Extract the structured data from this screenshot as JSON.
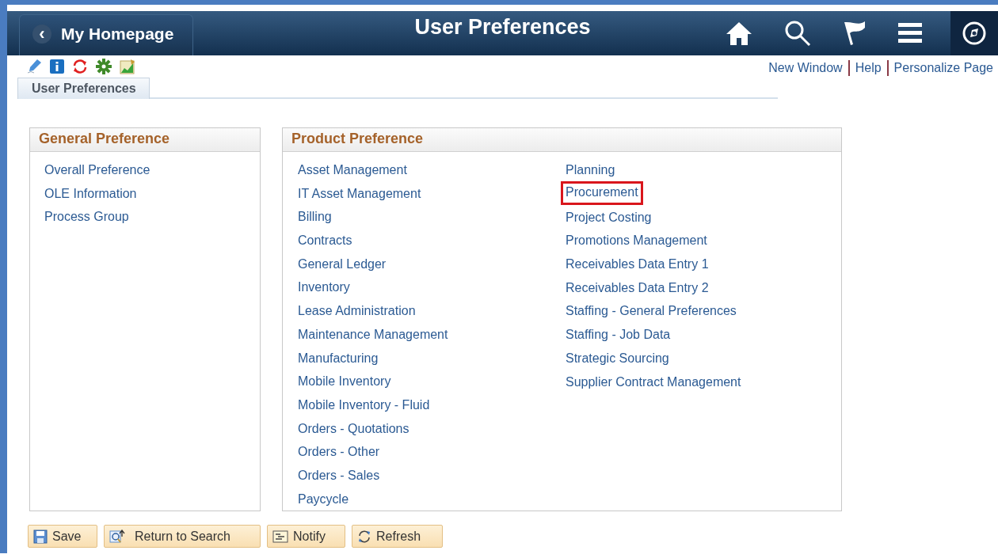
{
  "header": {
    "back_button": "My Homepage",
    "back_glyph": "‹",
    "title": "User Preferences"
  },
  "page_links": [
    "New Window",
    "Help",
    "Personalize Page"
  ],
  "tabs": [
    {
      "label": "User Preferences",
      "selected": true
    }
  ],
  "general_preference": {
    "title": "General Preference",
    "items": [
      "Overall Preference",
      "OLE Information",
      "Process Group"
    ]
  },
  "product_preference": {
    "title": "Product Preference",
    "columns": [
      {
        "items": [
          {
            "label": "Asset Management",
            "highlighted": false
          },
          {
            "label": "IT Asset Management",
            "highlighted": false
          },
          {
            "label": "Billing",
            "highlighted": false
          },
          {
            "label": "Contracts",
            "highlighted": false
          },
          {
            "label": "General Ledger",
            "highlighted": false
          },
          {
            "label": "Inventory",
            "highlighted": false
          },
          {
            "label": "Lease Administration",
            "highlighted": false
          },
          {
            "label": "Maintenance Management",
            "highlighted": false
          },
          {
            "label": "Manufacturing",
            "highlighted": false
          },
          {
            "label": "Mobile Inventory",
            "highlighted": false
          },
          {
            "label": "Mobile Inventory - Fluid",
            "highlighted": false
          },
          {
            "label": "Orders - Quotations",
            "highlighted": false
          },
          {
            "label": "Orders - Other",
            "highlighted": false
          },
          {
            "label": "Orders - Sales",
            "highlighted": false
          },
          {
            "label": "Paycycle",
            "highlighted": false
          }
        ]
      },
      {
        "items": [
          {
            "label": "Planning",
            "highlighted": false
          },
          {
            "label": "Procurement",
            "highlighted": true
          },
          {
            "label": "Project Costing",
            "highlighted": false
          },
          {
            "label": "Promotions Management",
            "highlighted": false
          },
          {
            "label": "Receivables Data Entry 1",
            "highlighted": false
          },
          {
            "label": "Receivables Data Entry 2",
            "highlighted": false
          },
          {
            "label": "Staffing - General Preferences",
            "highlighted": false
          },
          {
            "label": "Staffing - Job Data",
            "highlighted": false
          },
          {
            "label": "Strategic Sourcing",
            "highlighted": false
          },
          {
            "label": "Supplier Contract Management",
            "highlighted": false
          }
        ]
      }
    ]
  },
  "buttons": [
    {
      "label": "Save",
      "kind": "save"
    },
    {
      "label": "Return to Search",
      "kind": "search"
    },
    {
      "label": "Notify",
      "kind": "notify"
    },
    {
      "label": "Refresh",
      "kind": "refresh"
    }
  ]
}
